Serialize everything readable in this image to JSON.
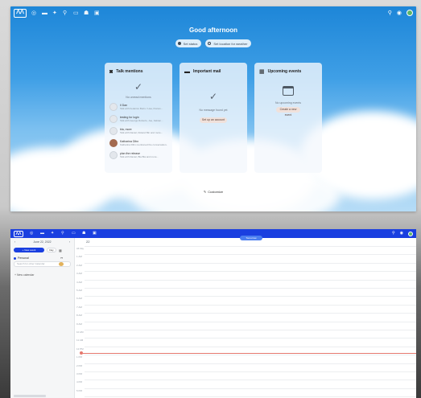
{
  "dashboard": {
    "greeting": "Good afternoon",
    "status": {
      "online_label": "Set status",
      "weather_label": "Set location for weather"
    },
    "panels": {
      "talk": {
        "title": "Talk mentions",
        "icon": "talk-icon",
        "empty_note": "No unread mentions",
        "mentions": [
          {
            "name": "Il Dan",
            "sub": "Talk with Federico Borin / Lisa, Florian..."
          },
          {
            "name": "testing for login",
            "sub": "Talk with George Roberts, Joe, Fabian..."
          },
          {
            "name": "bla, more",
            "sub": "Talk with Daniel, Roland Bin and more..."
          },
          {
            "name": "Katharina Dihn",
            "sub": "Katharina Dihn mentioned the conversation..."
          },
          {
            "name": "plan the release",
            "sub": "Talk with Daniel, Bla Bla and more..."
          }
        ]
      },
      "mail": {
        "title": "Important mail",
        "icon": "mail-icon",
        "empty_note": "No message found yet",
        "button": "Set up an account"
      },
      "events": {
        "title": "Upcoming events",
        "icon": "calendar-icon",
        "empty_note": "No upcoming events",
        "button": "Create a new event"
      }
    },
    "customize": "Customize"
  },
  "calendar": {
    "date_label": "June 22, 2022",
    "new_event": "+ New event",
    "view_label": "Day",
    "today_chip": "Tomorrow",
    "calendars": [
      {
        "name": "Personal",
        "color": "#1a3fe0"
      }
    ],
    "search_placeholder": "Search for other Calendar",
    "new_calendar": "+ New calendar",
    "column_header": "22",
    "hours": [
      "All day",
      "1 AM",
      "2 AM",
      "3 AM",
      "4 AM",
      "5 AM",
      "6 AM",
      "7 AM",
      "8 AM",
      "9 AM",
      "10 AM",
      "11 AM",
      "12 PM",
      "1 PM",
      "2 PM",
      "3 PM",
      "4 PM",
      "5 PM",
      "6 PM"
    ]
  },
  "colors": {
    "brand": "#1a3fe0",
    "sky_top": "#1d86d8",
    "now_indicator": "#e5796e"
  }
}
